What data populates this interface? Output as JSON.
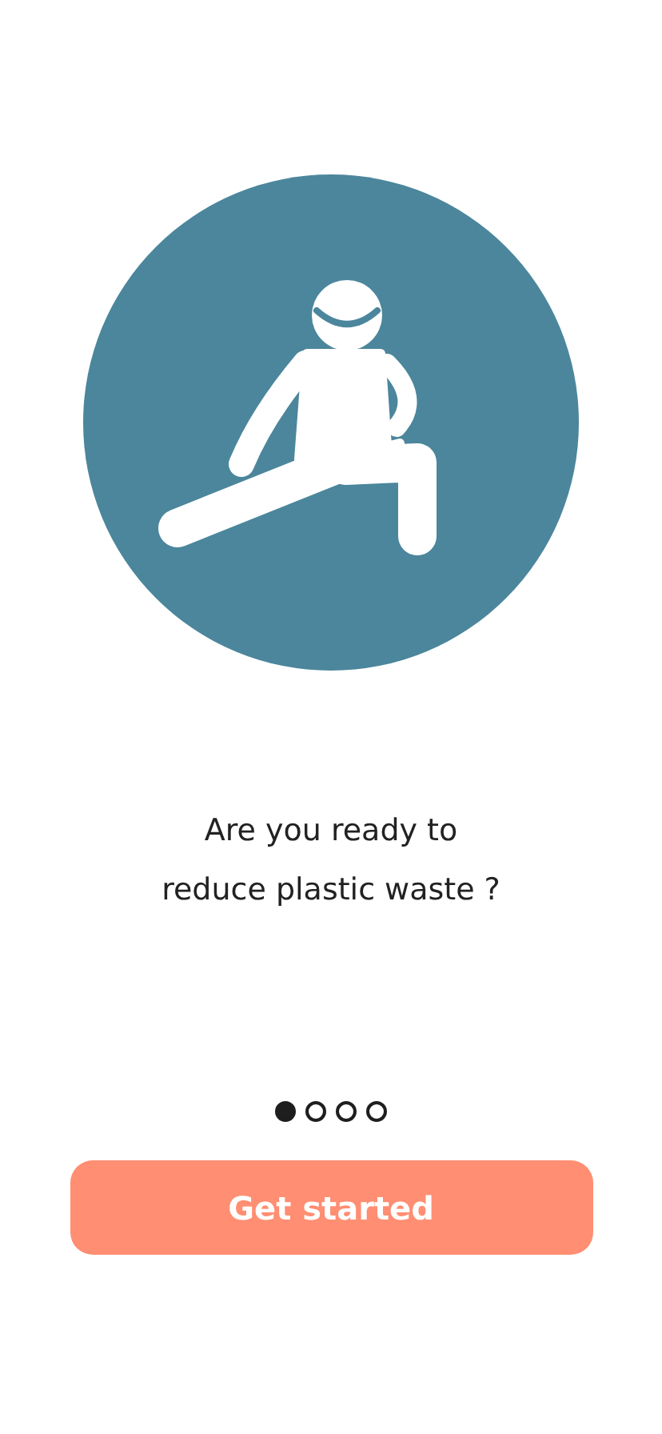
{
  "message": {
    "lines": [
      "Are you ready to",
      "reduce plastic waste ?"
    ]
  },
  "pager": [
    {
      "selected": true
    },
    {
      "selected": false
    },
    {
      "selected": false
    },
    {
      "selected": false
    }
  ],
  "button": {
    "label": "Get started"
  }
}
